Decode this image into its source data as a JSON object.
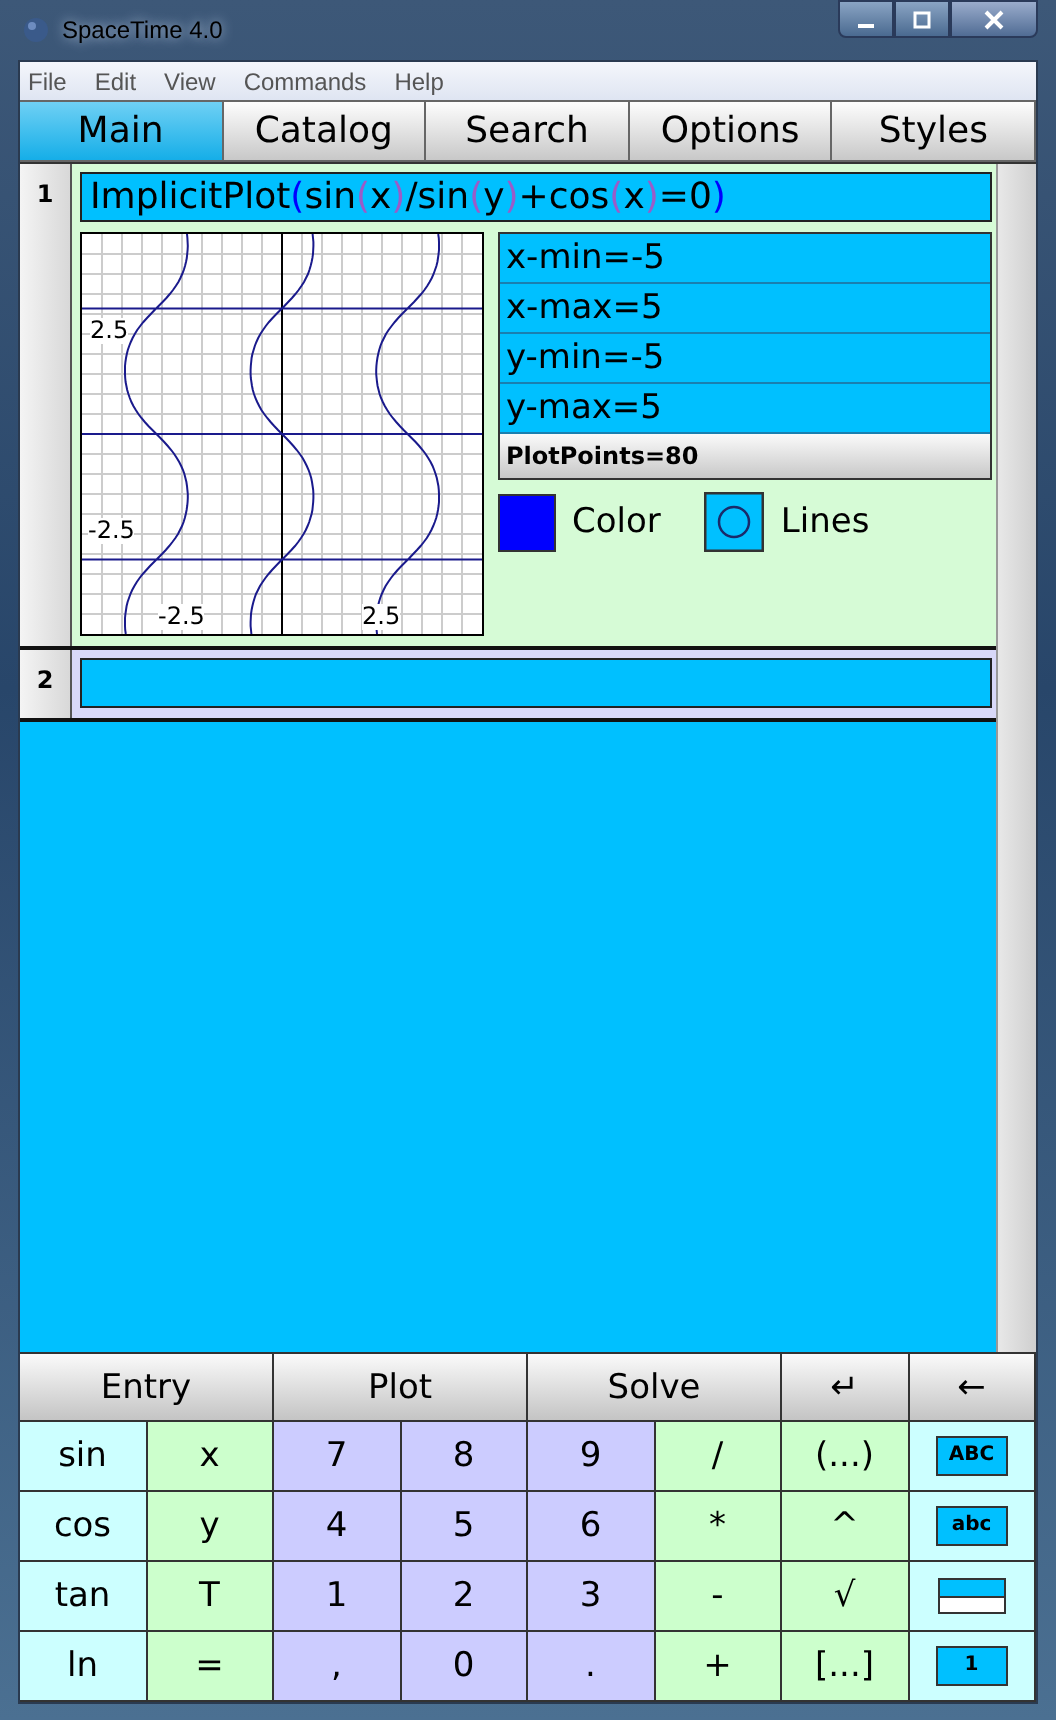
{
  "window": {
    "title": "SpaceTime 4.0"
  },
  "menu": [
    "File",
    "Edit",
    "View",
    "Commands",
    "Help"
  ],
  "tabs": [
    {
      "label": "Main",
      "selected": true
    },
    {
      "label": "Catalog",
      "selected": false
    },
    {
      "label": "Search",
      "selected": false
    },
    {
      "label": "Options",
      "selected": false
    },
    {
      "label": "Styles",
      "selected": false
    }
  ],
  "entries": [
    {
      "number": "1",
      "expression": [
        {
          "text": "ImplicitPlot",
          "kind": "text"
        },
        {
          "text": "(",
          "kind": "paren",
          "color": "#0000ff"
        },
        {
          "text": "sin",
          "kind": "text"
        },
        {
          "text": "(",
          "kind": "paren",
          "color": "#9a5cc8"
        },
        {
          "text": "x",
          "kind": "text"
        },
        {
          "text": ")",
          "kind": "paren",
          "color": "#9a5cc8"
        },
        {
          "text": "/sin",
          "kind": "text"
        },
        {
          "text": "(",
          "kind": "paren",
          "color": "#9a5cc8"
        },
        {
          "text": "y",
          "kind": "text"
        },
        {
          "text": ")",
          "kind": "paren",
          "color": "#9a5cc8"
        },
        {
          "text": "+cos",
          "kind": "text"
        },
        {
          "text": "(",
          "kind": "paren",
          "color": "#9a5cc8"
        },
        {
          "text": "x",
          "kind": "text"
        },
        {
          "text": ")",
          "kind": "paren",
          "color": "#9a5cc8"
        },
        {
          "text": "=0",
          "kind": "text"
        },
        {
          "text": ")",
          "kind": "paren",
          "color": "#0000ff"
        }
      ],
      "plot": {
        "xtick_labels": [
          "-2.5",
          "2.5"
        ],
        "ytick_labels": [
          "2.5",
          "-2.5"
        ],
        "settings": [
          {
            "text": "x-min=-5",
            "kind": "field"
          },
          {
            "text": "x-max=5",
            "kind": "field"
          },
          {
            "text": "y-min=-5",
            "kind": "field"
          },
          {
            "text": "y-max=5",
            "kind": "field"
          },
          {
            "text": "PlotPoints=80",
            "kind": "button"
          }
        ],
        "color": {
          "label": "Color",
          "color": "#0000ff"
        },
        "lines": {
          "label": "Lines"
        }
      }
    },
    {
      "number": "2"
    }
  ],
  "keyboard": {
    "top": [
      {
        "label": "Entry",
        "kind": "wide"
      },
      {
        "label": "Plot",
        "kind": "wide"
      },
      {
        "label": "Solve",
        "kind": "wide"
      },
      {
        "label": "↵",
        "kind": "narrow"
      },
      {
        "label": "←",
        "kind": "narrow"
      }
    ],
    "rows": [
      [
        {
          "label": "sin",
          "kind": "func"
        },
        {
          "label": "x",
          "kind": "op"
        },
        {
          "label": "7",
          "kind": "digit"
        },
        {
          "label": "8",
          "kind": "digit"
        },
        {
          "label": "9",
          "kind": "digit"
        },
        {
          "label": "/",
          "kind": "op"
        },
        {
          "label": "(...)",
          "kind": "op"
        },
        {
          "label": "ABC",
          "kind": "mode"
        }
      ],
      [
        {
          "label": "cos",
          "kind": "func"
        },
        {
          "label": "y",
          "kind": "op"
        },
        {
          "label": "4",
          "kind": "digit"
        },
        {
          "label": "5",
          "kind": "digit"
        },
        {
          "label": "6",
          "kind": "digit"
        },
        {
          "label": "*",
          "kind": "op"
        },
        {
          "label": "^",
          "kind": "op"
        },
        {
          "label": "abc",
          "kind": "mode"
        }
      ],
      [
        {
          "label": "tan",
          "kind": "func"
        },
        {
          "label": "T",
          "kind": "op"
        },
        {
          "label": "1",
          "kind": "digit"
        },
        {
          "label": "2",
          "kind": "digit"
        },
        {
          "label": "3",
          "kind": "digit"
        },
        {
          "label": "-",
          "kind": "op"
        },
        {
          "label": "√",
          "kind": "op"
        },
        {
          "kind": "fraction"
        }
      ],
      [
        {
          "label": "ln",
          "kind": "func"
        },
        {
          "label": "=",
          "kind": "op"
        },
        {
          "label": ",",
          "kind": "digit"
        },
        {
          "label": "0",
          "kind": "digit"
        },
        {
          "label": ".",
          "kind": "digit"
        },
        {
          "label": "+",
          "kind": "op"
        },
        {
          "label": "[...]",
          "kind": "op"
        },
        {
          "label": "1",
          "kind": "mode"
        }
      ]
    ]
  }
}
